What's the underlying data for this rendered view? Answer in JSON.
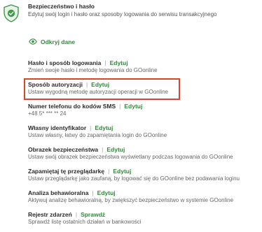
{
  "header": {
    "title": "Bezpieczeństwo i hasło",
    "description": "Edytuj swój login i hasło oraz sposoby logowania do serwisu transakcyjnego"
  },
  "reveal": {
    "label": "Odkryj dane"
  },
  "items": [
    {
      "title": "Hasło i sposób logowania",
      "action": "Edytuj",
      "description": "Zmień swoje hasło i metodę logowania do GOonline"
    },
    {
      "title": "Sposób autoryzacji",
      "action": "Edytuj",
      "description": "Ustaw wygodną metodę autoryzacji operacji w GOonline"
    },
    {
      "title": "Numer telefonu do kodów SMS",
      "action": "Edytuj",
      "description": "+48 5* *** ** 24"
    },
    {
      "title": "Własny identyfikator",
      "action": "Edytuj",
      "description": "Ustaw własny, łatwy do zapamiętania login do GOonline"
    },
    {
      "title": "Obrazek bezpieczeństwa",
      "action": "Edytuj",
      "description": "Ustaw swój obrazek bezpieczeństwa wyświetlany podczas logowania do GOonline"
    },
    {
      "title": "Zapamiętaj tę przeglądarkę",
      "action": "Edytuj",
      "description": "Ustaw przeglądarkę jako zaufaną, by logować się do GOonline bez podawania loginu"
    },
    {
      "title": "Analiza behawioralna",
      "action": "Edytuj",
      "description": "Aktywuj analizę behawioralną, by zwiększyć bezpieczeństwo w systemie GOonline"
    },
    {
      "title": "Rejestr zdarzeń",
      "action": "Sprawdź",
      "description": "Sprawdź listę ostatnich działań w bankowości"
    }
  ],
  "colors": {
    "accent": "#2f8a3b",
    "highlight_border": "#d9442c",
    "shield_fill": "#3d9a47"
  },
  "icons": {
    "header": "shield-check-icon",
    "reveal": "eye-icon"
  }
}
